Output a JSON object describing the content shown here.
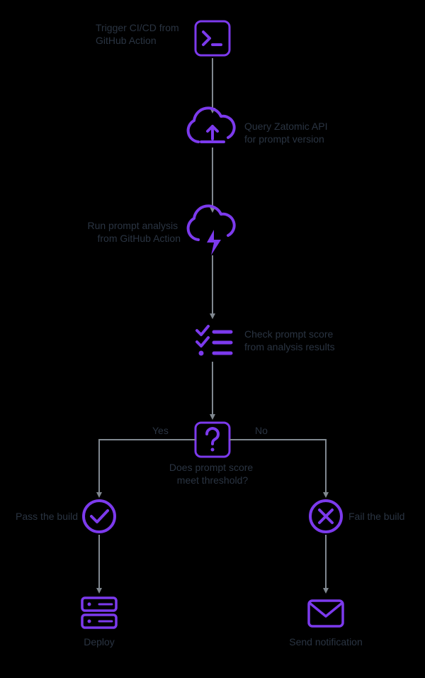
{
  "colors": {
    "accent": "#7c3aed",
    "text": "#2a3442",
    "arrow": "#808890",
    "bg": "#000000"
  },
  "nodes": {
    "trigger": {
      "label": [
        "Trigger CI/CD from",
        "GitHub Action"
      ],
      "icon": "terminal-icon"
    },
    "query": {
      "label": [
        "Query Zatomic API",
        "for prompt version"
      ],
      "icon": "cloud-upload-icon"
    },
    "analysis": {
      "label": [
        "Run prompt analysis",
        "from GitHub Action"
      ],
      "icon": "cloud-lightning-icon"
    },
    "check": {
      "label": [
        "Check prompt score",
        "from analysis results"
      ],
      "icon": "checklist-icon"
    },
    "decision": {
      "label": [
        "Does prompt score",
        "meet threshold?"
      ],
      "icon": "question-icon"
    },
    "pass": {
      "label": [
        "Pass the build"
      ],
      "icon": "check-circle-icon"
    },
    "fail": {
      "label": [
        "Fail the build"
      ],
      "icon": "x-circle-icon"
    },
    "deploy": {
      "label": [
        "Deploy"
      ],
      "icon": "server-icon"
    },
    "notify": {
      "label": [
        "Send notification"
      ],
      "icon": "mail-icon"
    }
  },
  "branches": {
    "yes": "Yes",
    "no": "No"
  }
}
